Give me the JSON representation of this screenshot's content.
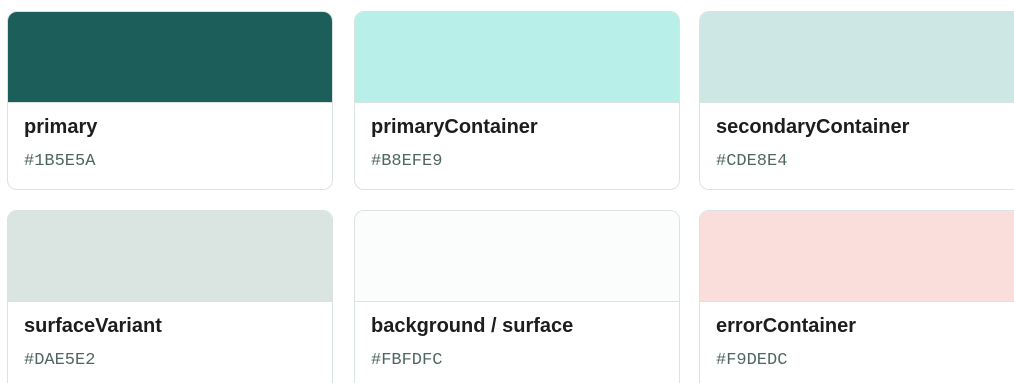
{
  "swatches": [
    {
      "name": "primary",
      "hex": "#1B5E5A",
      "color": "#1B5E5A"
    },
    {
      "name": "primaryContainer",
      "hex": "#B8EFE9",
      "color": "#B8EFE9"
    },
    {
      "name": "secondaryContainer",
      "hex": "#CDE8E4",
      "color": "#CDE8E4"
    },
    {
      "name": "surfaceVariant",
      "hex": "#DAE5E2",
      "color": "#DAE5E2"
    },
    {
      "name": "background / surface",
      "hex": "#FBFDFC",
      "color": "#FBFDFC"
    },
    {
      "name": "errorContainer",
      "hex": "#F9DEDC",
      "color": "#F9DEDC"
    }
  ]
}
